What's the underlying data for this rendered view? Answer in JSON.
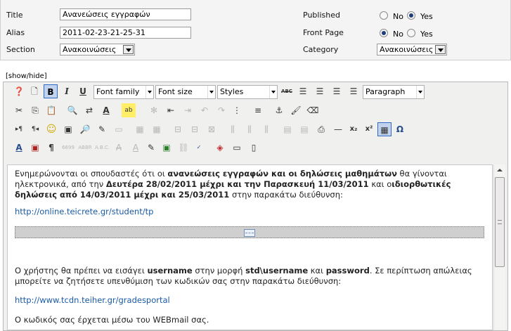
{
  "form": {
    "title_label": "Title",
    "title_value": "Ανανεώσεις εγγραφών",
    "alias_label": "Alias",
    "alias_value": "2011-02-23-21-25-31",
    "section_label": "Section",
    "section_value": "Ανακοινώσεις",
    "published_label": "Published",
    "frontpage_label": "Front Page",
    "category_label": "Category",
    "category_value": "Ανακοινώσεις",
    "no": "No",
    "yes": "Yes",
    "published_selected": "Yes",
    "frontpage_selected": "No"
  },
  "editor": {
    "toggle": "[show/hide]",
    "font_family": "Font family",
    "font_size": "Font size",
    "styles": "Styles",
    "format": "Paragraph",
    "bold": "B",
    "italic": "I",
    "underline": "U",
    "strike": "ABC",
    "omega": "Ω"
  },
  "content": {
    "p1_a": "Ενημερώνονται οι σπουδαστές ότι οι ",
    "p1_b": "ανανεώσεις εγγραφών και οι δηλώσεις μαθημάτων",
    "p1_c": " θα γίνονται ηλεκτρονικά, από την ",
    "p1_d": "Δευτέρα 28/02/2011 μέχρι και την Παρασκευή 11/03/2011",
    "p1_e": " και ο",
    "p1_f": "ιδιορθωτικές δηλώσεις από 14/03/2011 μέχρι και 25/03/2011",
    "p1_g": " στην παρακάτω διεύθυνση:",
    "link1": "http://online.teicrete.gr/student/tp",
    "p2_a": "Ο χρήστης θα πρέπει να εισάγει ",
    "p2_b": "username",
    "p2_c": " στην μορφή ",
    "p2_d": "std\\username",
    "p2_e": " και ",
    "p2_f": "password",
    "p2_g": ". Σε περίπτωση απώλειας μπορείτε να ζητήσετε υπενθύμιση των κωδικών σας στην παρακάτω διεύθυνση:",
    "link2": "http://www.tcdn.teiher.gr/gradesportal",
    "p3": "Ο κωδικός σας έρχεται μέσω του WEBmail σας."
  },
  "colors": {
    "accent": "#316ac5",
    "link": "#1a5aa6",
    "toolbar_bg": "#f0f0ee"
  }
}
